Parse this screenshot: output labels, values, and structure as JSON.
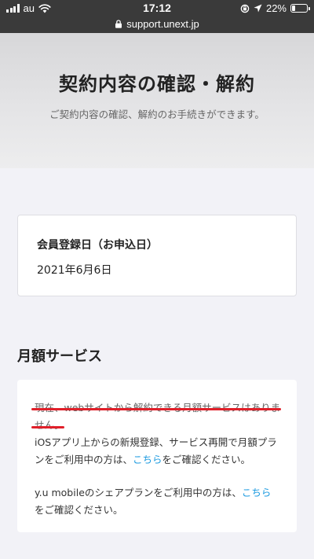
{
  "status_bar": {
    "carrier": "au",
    "time": "17:12",
    "battery_percent": "22%",
    "battery_level": 0.22
  },
  "browser": {
    "url": "support.unext.jp"
  },
  "header": {
    "title": "契約内容の確認・解約",
    "subtitle": "ご契約内容の確認、解約のお手続きができます。"
  },
  "registration": {
    "label": "会員登録日（お申込日）",
    "date": "2021年6月6日"
  },
  "monthly_services": {
    "heading": "月額サービス",
    "notice_line1": "現在、webサイトから解約できる月額サービスはありま",
    "notice_line2": "せん。",
    "ios_line1": "iOSアプリ上からの新規登録、サービス再開で月額プラ",
    "ios_line2_prefix": "ンをご利用中の方は、",
    "ios_link": "こちら",
    "ios_line2_suffix": "をご確認ください。",
    "ymobile_line1_prefix": "y.u mobileのシェアプランをご利用中の方は、",
    "ymobile_link": "こちら",
    "ymobile_line2": "をご確認ください。"
  },
  "colors": {
    "link": "#1e9be0",
    "highlight_underline": "#e0202a",
    "status_bar_bg": "#3a3a3a"
  },
  "icons": [
    "signal-icon",
    "wifi-icon",
    "orientation-lock-icon",
    "location-arrow-icon",
    "battery-icon",
    "lock-icon"
  ]
}
